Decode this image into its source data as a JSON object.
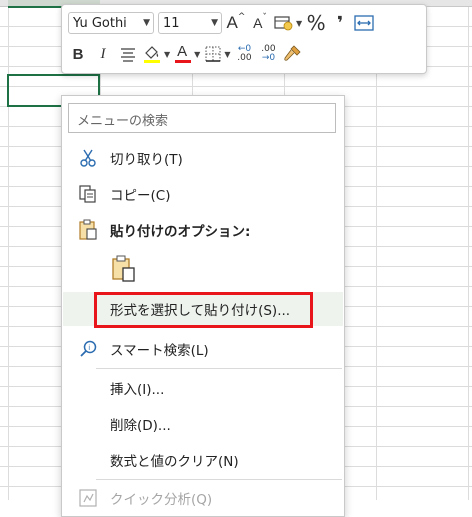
{
  "mini_toolbar": {
    "font_name": "Yu Gothi",
    "font_size": "11",
    "increase_font_label": "A",
    "decrease_font_label": "A",
    "percent_label": "%",
    "comma_label": "❜",
    "bold_label": "B",
    "italic_label": "I",
    "font_color_label": "A",
    "inc_decimal_top": "←0",
    "inc_decimal_bottom": ".00",
    "dec_decimal_top": ".00",
    "dec_decimal_bottom": "→0",
    "fill_color": "#ffff00",
    "font_color": "#e8161b"
  },
  "context_menu": {
    "search_placeholder": "メニューの検索",
    "items": [
      {
        "label": "切り取り(T)",
        "icon": "scissors-icon"
      },
      {
        "label": "コピー(C)",
        "icon": "copy-icon"
      },
      {
        "label": "貼り付けのオプション:",
        "icon": "clipboard-icon"
      },
      {
        "label": "形式を選択して貼り付け(S)...",
        "icon": ""
      },
      {
        "label": "スマート検索(L)",
        "icon": "search-icon"
      },
      {
        "label": "挿入(I)...",
        "icon": ""
      },
      {
        "label": "削除(D)...",
        "icon": ""
      },
      {
        "label": "数式と値のクリア(N)",
        "icon": ""
      },
      {
        "label": "クイック分析(Q)",
        "icon": "quick-analysis-icon"
      }
    ],
    "highlight_color": "#e8161b"
  }
}
